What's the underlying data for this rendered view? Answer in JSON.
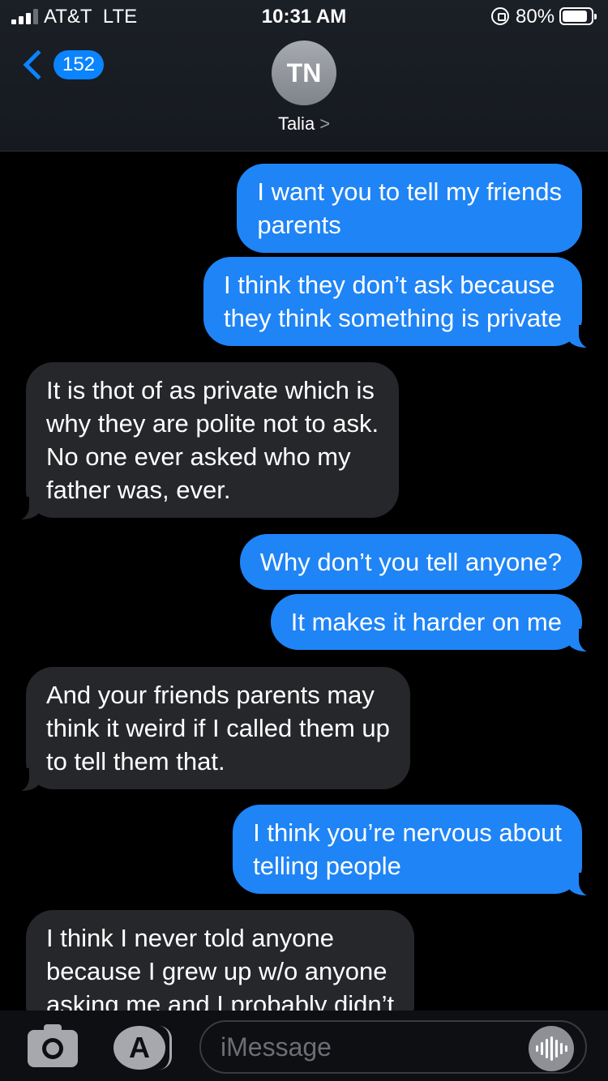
{
  "status_bar": {
    "carrier": "AT&T",
    "network": "LTE",
    "time": "10:31 AM",
    "battery": "80%",
    "battery_level": 0.8
  },
  "header": {
    "back_count": "152",
    "avatar_initials": "TN",
    "contact_name": "Talia",
    "contact_caret": ">"
  },
  "messages": [
    {
      "direction": "out",
      "lines": [
        "I want you to tell my friends",
        "parents"
      ]
    },
    {
      "direction": "out",
      "lines": [
        "I think they don’t ask because",
        "they think something is private"
      ]
    },
    {
      "direction": "in",
      "lines": [
        "It is thot of as private which is",
        "why they are polite not to ask.",
        "No one ever asked who my",
        "father was, ever."
      ]
    },
    {
      "direction": "out",
      "lines": [
        "Why don’t you tell anyone?"
      ]
    },
    {
      "direction": "out",
      "lines": [
        "It makes it harder on me"
      ]
    },
    {
      "direction": "in",
      "lines": [
        "And your friends parents may",
        "think it weird if I called them up",
        "to tell them that."
      ]
    },
    {
      "direction": "out",
      "lines": [
        "I think you’re nervous about",
        "telling people"
      ]
    },
    {
      "direction": "in",
      "lines": [
        "I think I never told anyone",
        "because I grew up w/o anyone",
        "asking me and I probably didn’t"
      ]
    }
  ],
  "input_bar": {
    "placeholder": "iMessage",
    "icons": [
      "camera-icon",
      "app-store-icon",
      "audio-message-icon"
    ]
  },
  "colors": {
    "outgoing_bubble": "#1f84f6",
    "incoming_bubble": "#26272b",
    "accent": "#0a84ff",
    "background": "#000000"
  }
}
